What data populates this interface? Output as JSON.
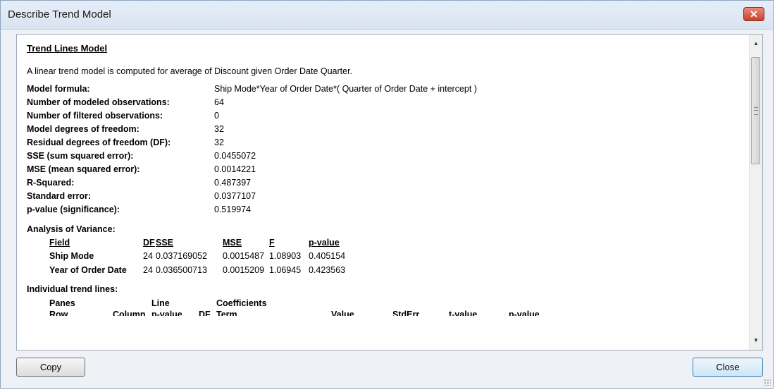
{
  "window": {
    "title": "Describe Trend Model",
    "close_glyph": "✕"
  },
  "report": {
    "heading": "Trend Lines Model",
    "intro": "A linear trend model is computed for average of Discount given Order Date Quarter.",
    "stats": [
      {
        "label": "Model formula:",
        "value": "Ship Mode*Year of Order Date*( Quarter of Order Date + intercept )"
      },
      {
        "label": "Number of modeled observations:",
        "value": "64"
      },
      {
        "label": "Number of filtered observations:",
        "value": "0"
      },
      {
        "label": "Model degrees of freedom:",
        "value": "32"
      },
      {
        "label": "Residual degrees of freedom (DF):",
        "value": "32"
      },
      {
        "label": "SSE (sum squared error):",
        "value": "0.0455072"
      },
      {
        "label": "MSE (mean squared error):",
        "value": "0.0014221"
      },
      {
        "label": "R-Squared:",
        "value": "0.487397"
      },
      {
        "label": "Standard error:",
        "value": "0.0377107"
      },
      {
        "label": "p-value (significance):",
        "value": "0.519974"
      }
    ],
    "anova": {
      "title": "Analysis of Variance:",
      "headers": {
        "field": "Field",
        "df": "DF",
        "sse": "SSE",
        "mse": "MSE",
        "f": "F",
        "p": "p-value"
      },
      "rows": [
        {
          "field": "Ship Mode",
          "df": "24",
          "sse": "0.037169052",
          "mse": "0.0015487",
          "f": "1.08903",
          "p": "0.405154"
        },
        {
          "field": "Year of Order Date",
          "df": "24",
          "sse": "0.036500713",
          "mse": "0.0015209",
          "f": "1.06945",
          "p": "0.423563"
        }
      ]
    },
    "trend": {
      "title": "Individual trend lines:",
      "group_headers": {
        "panes": "Panes",
        "line": "Line",
        "coefficients": "Coefficients"
      },
      "cut_headers": [
        "Row",
        "Column",
        "p-value",
        "DF",
        "Term",
        "Value",
        "StdErr",
        "t-value",
        "p-value"
      ]
    }
  },
  "buttons": {
    "copy": "Copy",
    "close": "Close"
  },
  "scrollbar": {
    "up": "▲",
    "down": "▼"
  }
}
